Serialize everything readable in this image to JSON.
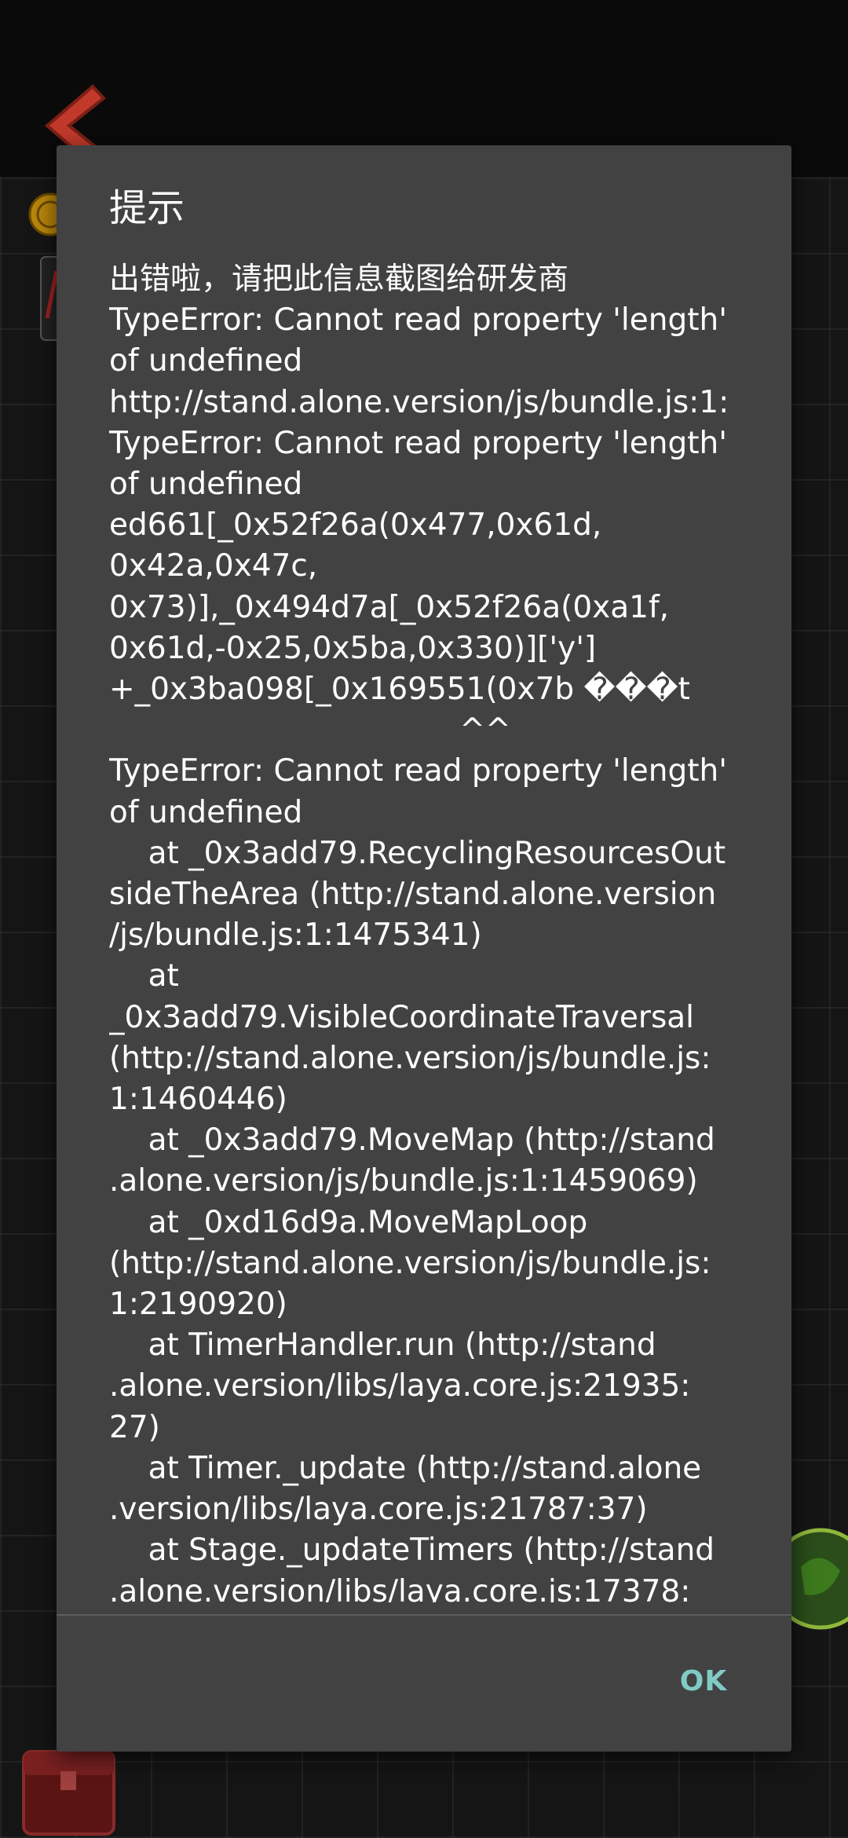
{
  "dialog": {
    "title": "提示",
    "message": "出错啦，请把此信息截图给研发商\nTypeError: Cannot read property 'length'\nof undefined\nhttp://stand.alone.version/js/bundle.js:1:\nTypeError: Cannot read property 'length'\nof undefined\ned661[_0x52f26a(0x477,0x61d,\n0x42a,0x47c,\n0x73)],_0x494d7a[_0x52f26a(0xa1f,\n0x61d,-0x25,0x5ba,0x330)]['y']\n+_0x3ba098[_0x169551(0x7b ���t\n                                    ^^\nTypeError: Cannot read property 'length'\nof undefined\n    at _0x3add79.RecyclingResourcesOut\nsideTheArea (http://stand.alone.version\n/js/bundle.js:1:1475341)\n    at\n_0x3add79.VisibleCoordinateTraversal\n(http://stand.alone.version/js/bundle.js:\n1:1460446)\n    at _0x3add79.MoveMap (http://stand\n.alone.version/js/bundle.js:1:1459069)\n    at _0xd16d9a.MoveMapLoop\n(http://stand.alone.version/js/bundle.js:\n1:2190920)\n    at TimerHandler.run (http://stand\n.alone.version/libs/laya.core.js:21935:\n27)\n    at Timer._update (http://stand.alone\n.version/libs/laya.core.js:21787:37)\n    at Stage._updateTimers (http://stand\n.alone.version/libs/laya.core.js:17378:",
    "ok_label": "OK"
  },
  "colors": {
    "dialog_bg": "#424242",
    "ok_text": "#80cbc4",
    "text": "#ffffff"
  },
  "background_icons": [
    "back-arrow-icon",
    "coin-icon",
    "bomb-icon",
    "chest-icon"
  ]
}
